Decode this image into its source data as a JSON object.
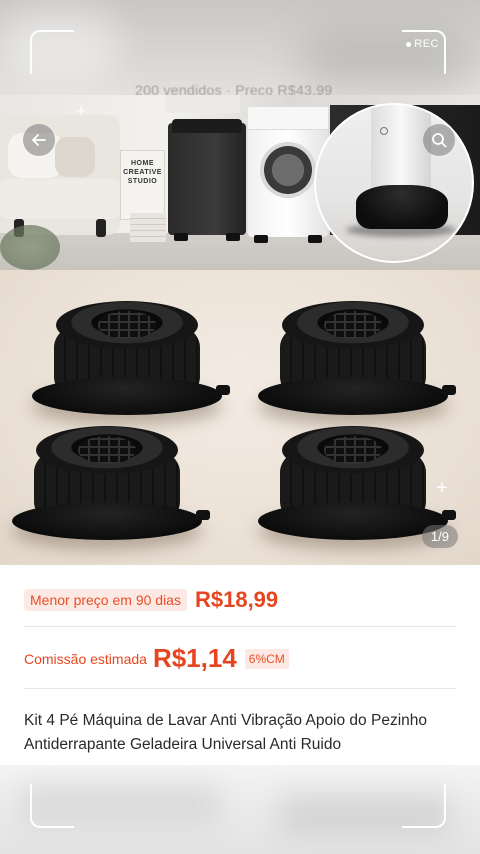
{
  "overlay": {
    "rec_label": "REC",
    "ghost_header_text": "200 vendidos · Preço R$43,99"
  },
  "gallery": {
    "poster_text": "HOME\nCREATIVE\nSTUDIO",
    "counter": "1/9",
    "icons": {
      "back": "arrow-left-icon",
      "search": "search-icon",
      "plus": "plus-icon"
    }
  },
  "pricing": {
    "lowest_label": "Menor preço em 90 dias",
    "lowest_price": "R$18,99",
    "commission_label": "Comissão estimada",
    "commission_value": "R$1,14",
    "commission_rate": "6%CM",
    "accent_color": "#e6451f"
  },
  "product": {
    "title": "Kit 4 Pé Máquina de Lavar Anti Vibração Apoio do Pezinho Antiderrapante Geladeira Universal Anti Ruido"
  }
}
